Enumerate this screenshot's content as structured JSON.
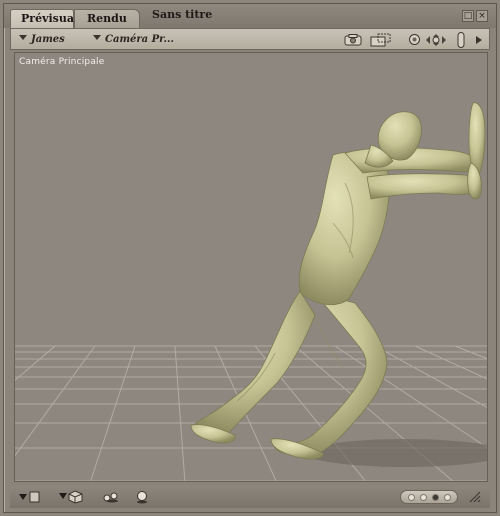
{
  "tabs": [
    {
      "label": "Prévisual.",
      "active": true
    },
    {
      "label": "Rendu",
      "active": false
    }
  ],
  "document": {
    "title": "Sans titre"
  },
  "toolbar": {
    "figure_menu": "James",
    "camera_menu": "Caméra Pr..."
  },
  "viewport": {
    "camera_label": "Caméra Principale",
    "background_color": "#8e8780",
    "floor_grid": true,
    "figure_color": "#c8c59a"
  },
  "icons": {
    "toolbar": [
      "render-icon",
      "render-settings-icon",
      "light-icon",
      "move-icon",
      "figure-icon",
      "expand-icon"
    ],
    "bottom": [
      "document-style-icon",
      "display-style-icon",
      "ground-shadow-icon",
      "lighting-icon"
    ]
  },
  "pager": {
    "pages": 4,
    "active": 2
  }
}
